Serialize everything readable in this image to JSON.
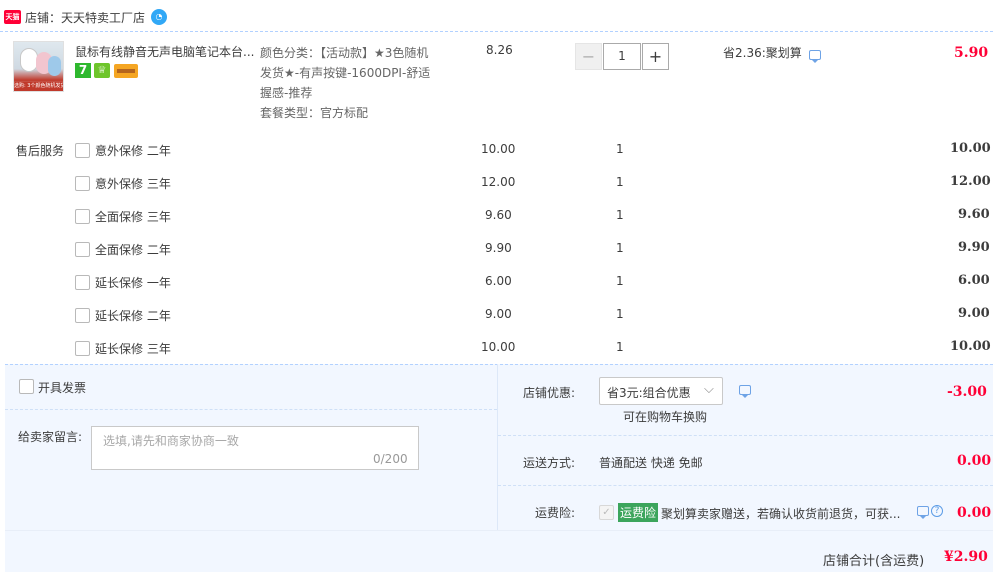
{
  "shop": {
    "logo_text": "天猫",
    "name": "店铺：天天特卖工厂店",
    "ww_icon": "wangwang-chat-icon"
  },
  "item": {
    "thumb_caption": "选购: 3个颜色随机发货",
    "title": "鼠标有线静音无声电脑笔记本台...",
    "badge_7": "7",
    "sku_lines": [
      "颜色分类：【活动款】★3色随机",
      "发货★-有声按键-1600DPI-舒适",
      "握感-推荐",
      "套餐类型：官方标配"
    ],
    "price": "8.26",
    "qty": "1",
    "minus": "−",
    "plus": "+",
    "saving": "省2.36:聚划算",
    "total": "5.90"
  },
  "services": {
    "label": "售后服务",
    "rows": [
      {
        "name": "意外保修 二年",
        "price": "10.00",
        "qty": "1",
        "total": "10.00"
      },
      {
        "name": "意外保修 三年",
        "price": "12.00",
        "qty": "1",
        "total": "12.00"
      },
      {
        "name": "全面保修 三年",
        "price": "9.60",
        "qty": "1",
        "total": "9.60"
      },
      {
        "name": "全面保修 二年",
        "price": "9.90",
        "qty": "1",
        "total": "9.90"
      },
      {
        "name": "延长保修 一年",
        "price": "6.00",
        "qty": "1",
        "total": "6.00"
      },
      {
        "name": "延长保修 二年",
        "price": "9.00",
        "qty": "1",
        "total": "9.00"
      },
      {
        "name": "延长保修 三年",
        "price": "10.00",
        "qty": "1",
        "total": "10.00"
      }
    ]
  },
  "invoice": {
    "label": "开具发票"
  },
  "message": {
    "label": "给卖家留言:",
    "placeholder": "选填,请先和商家协商一致",
    "counter": "0/200"
  },
  "coupon": {
    "label": "店铺优惠:",
    "selected": "省3元:组合优惠",
    "hint": "可在购物车换购",
    "amount": "-3.00"
  },
  "shipping": {
    "label": "运送方式:",
    "value": "普通配送 快递 免邮",
    "amount": "0.00"
  },
  "insurance": {
    "label": "运费险:",
    "tag": "运费险",
    "desc": "聚划算卖家赠送，若确认收货前退货，可获...",
    "amount": "0.00",
    "help": "?"
  },
  "footer": {
    "label": "店铺合计(含运费)",
    "total": "¥2.90"
  },
  "colors": {
    "price_red": "#ff0036",
    "accent_blue": "#b2d1ff",
    "panel_bg": "#f2f7ff"
  }
}
